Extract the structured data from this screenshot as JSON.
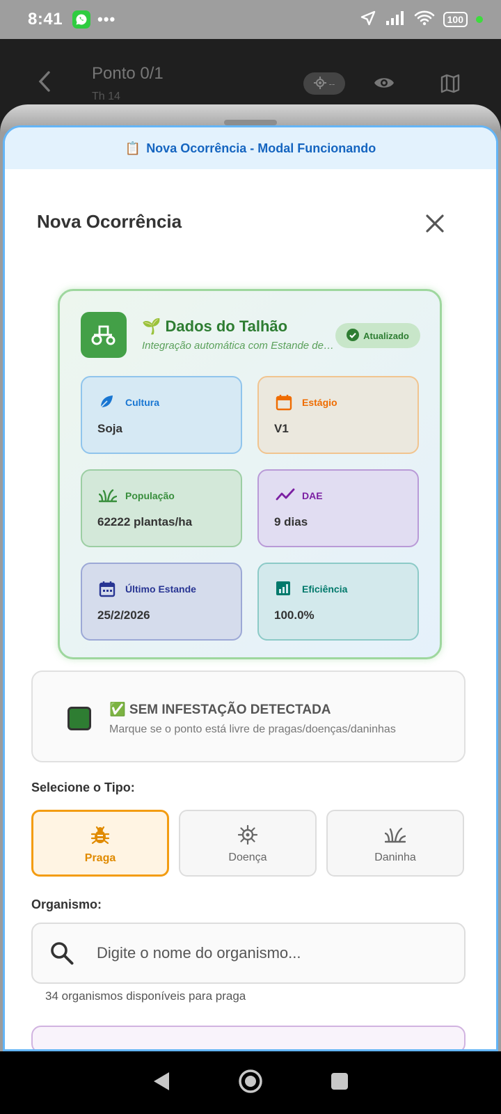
{
  "status_bar": {
    "time": "8:41",
    "dots": "•••",
    "battery": "100"
  },
  "app_bar": {
    "title": "Ponto 0/1",
    "subtitle": "Th 14",
    "gps_label": "--"
  },
  "banner": {
    "icon": "📋",
    "text": "Nova Ocorrência - Modal Funcionando"
  },
  "modal": {
    "title": "Nova Ocorrência"
  },
  "talhao": {
    "title": "🌱 Dados do Talhão",
    "subtitle": "Integração automática com Estande de Plantas",
    "badge": "Atualizado",
    "tiles": [
      {
        "label": "Cultura",
        "value": "Soja",
        "color": "#1976d2"
      },
      {
        "label": "Estágio",
        "value": "V1",
        "color": "#ef6c00"
      },
      {
        "label": "População",
        "value": "62222 plantas/ha",
        "color": "#388e3c"
      },
      {
        "label": "DAE",
        "value": "9 dias",
        "color": "#7b1fa2"
      },
      {
        "label": "Último Estande",
        "value": "25/2/2026",
        "color": "#283593"
      },
      {
        "label": "Eficiência",
        "value": "100.0%",
        "color": "#00796b"
      }
    ]
  },
  "no_infestation": {
    "title": "✅ SEM INFESTAÇÃO DETECTADA",
    "hint": "Marque se o ponto está livre de pragas/doenças/daninhas"
  },
  "type_section": {
    "label": "Selecione o Tipo:",
    "options": [
      "Praga",
      "Doença",
      "Daninha"
    ],
    "selected": "Praga"
  },
  "organism": {
    "label": "Organismo:",
    "placeholder": "Digite o nome do organismo...",
    "count_text": "34 organismos disponíveis para praga"
  },
  "colors": {
    "accent_blue": "#1565c0",
    "accent_green": "#43a047",
    "accent_orange": "#f39c12"
  }
}
